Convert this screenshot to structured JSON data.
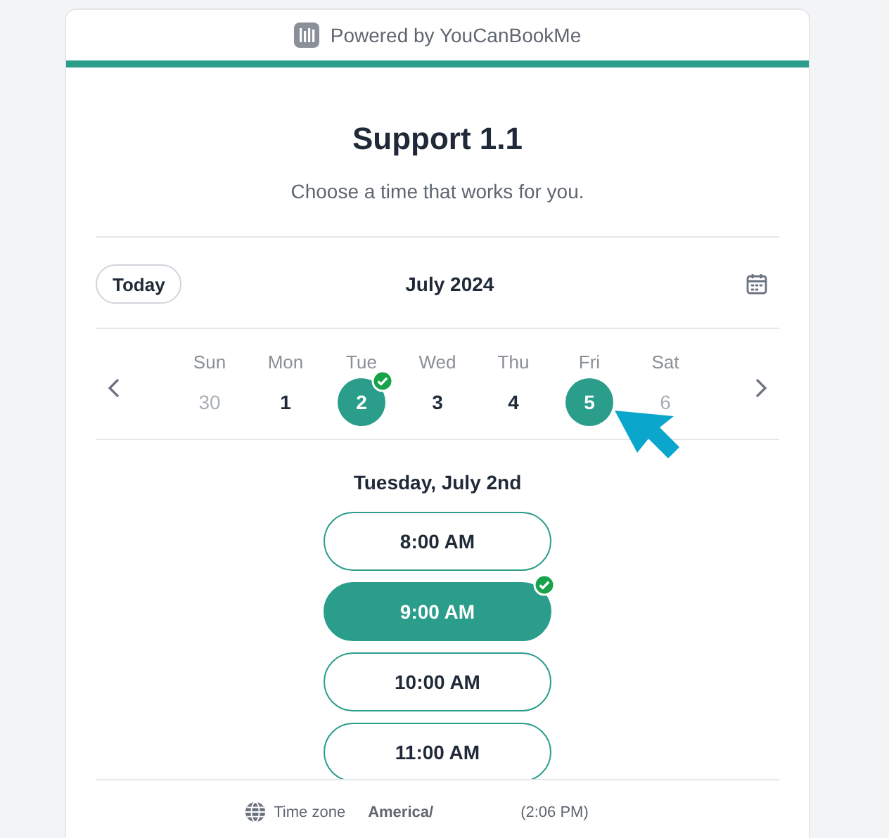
{
  "header": {
    "text": "Powered by YouCanBookMe"
  },
  "title": "Support 1.1",
  "subtitle": "Choose a time that works for you.",
  "nav": {
    "today": "Today",
    "month": "July 2024"
  },
  "days": [
    {
      "weekday": "Sun",
      "date": "30",
      "available": false,
      "selected": false,
      "booked": false
    },
    {
      "weekday": "Mon",
      "date": "1",
      "available": true,
      "selected": false,
      "booked": false
    },
    {
      "weekday": "Tue",
      "date": "2",
      "available": true,
      "selected": true,
      "booked": true
    },
    {
      "weekday": "Wed",
      "date": "3",
      "available": true,
      "selected": false,
      "booked": false
    },
    {
      "weekday": "Thu",
      "date": "4",
      "available": true,
      "selected": false,
      "booked": false
    },
    {
      "weekday": "Fri",
      "date": "5",
      "available": true,
      "selected": true,
      "booked": false
    },
    {
      "weekday": "Sat",
      "date": "6",
      "available": false,
      "selected": false,
      "booked": false
    }
  ],
  "day_heading": "Tuesday, July 2nd",
  "slots": [
    {
      "time": "8:00 AM",
      "selected": false,
      "booked": false
    },
    {
      "time": "9:00 AM",
      "selected": true,
      "booked": true
    },
    {
      "time": "10:00 AM",
      "selected": false,
      "booked": false
    },
    {
      "time": "11:00 AM",
      "selected": false,
      "booked": false
    }
  ],
  "footer": {
    "label": "Time zone",
    "zone": "America/",
    "time": "(2:06 PM)"
  }
}
